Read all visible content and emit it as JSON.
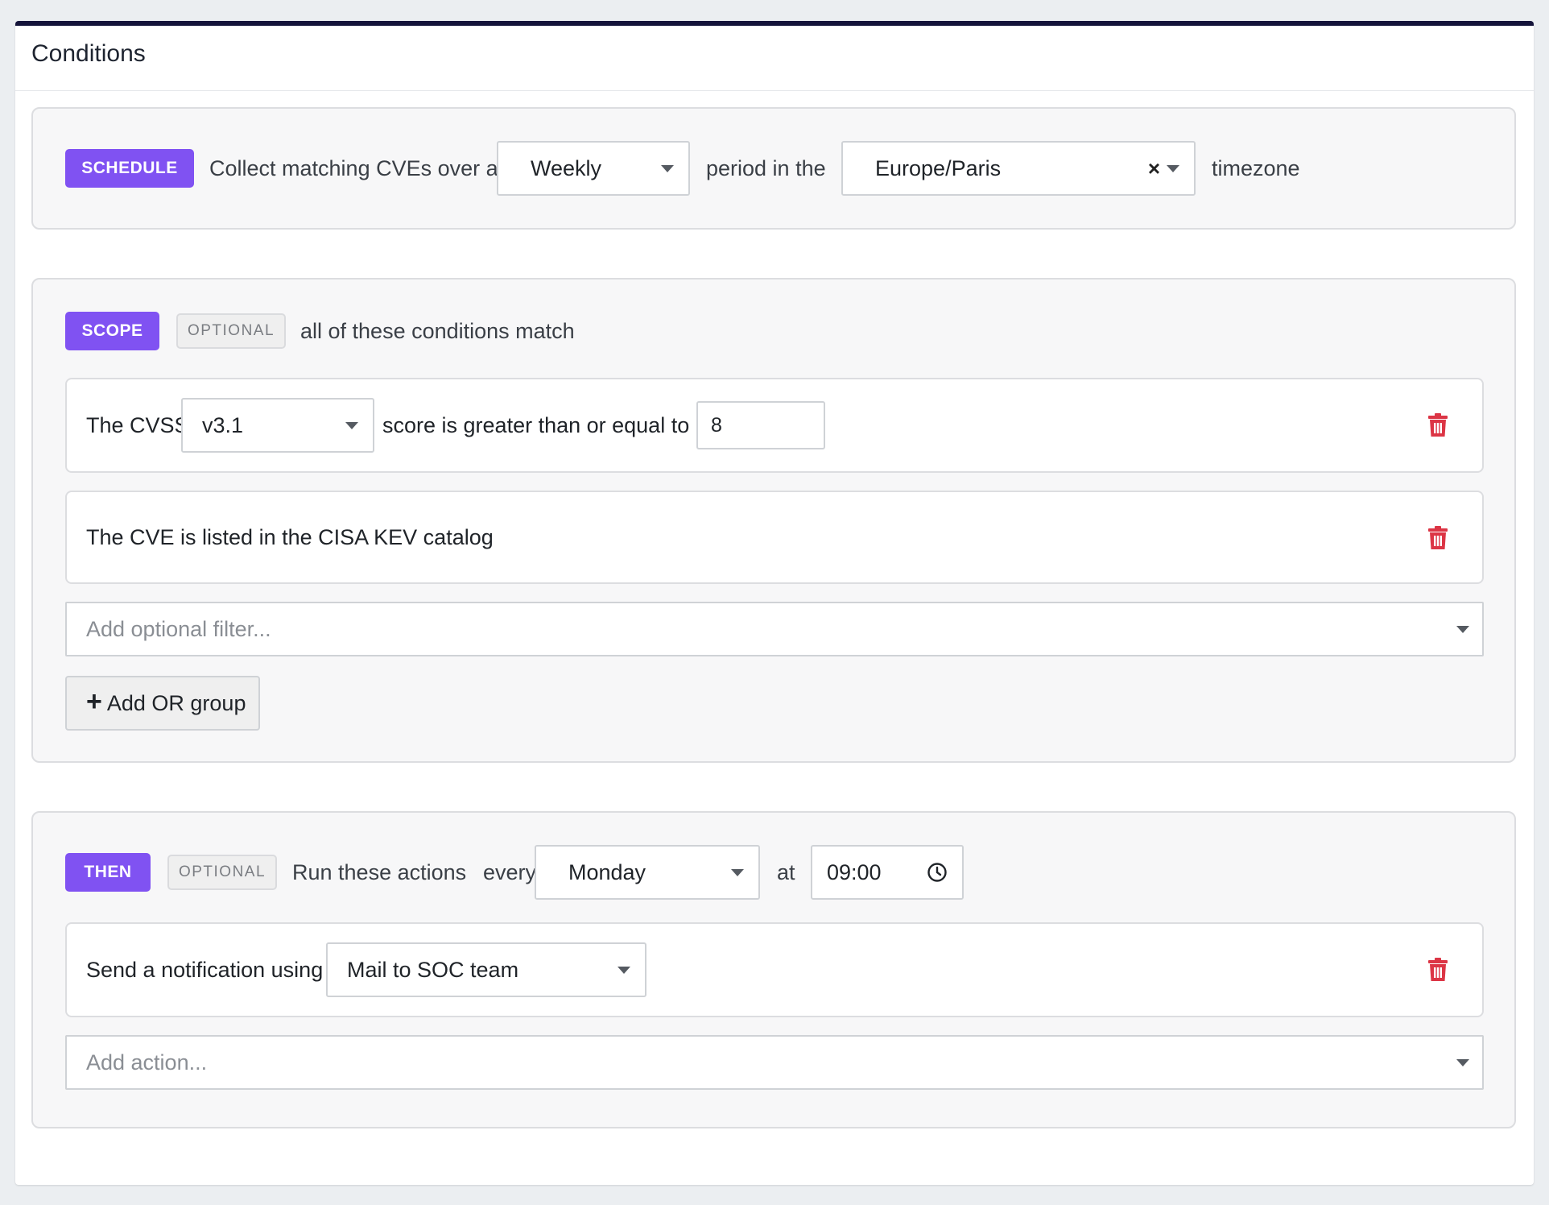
{
  "card": {
    "title": "Conditions"
  },
  "schedule": {
    "badge": "SCHEDULE",
    "text_before": "Collect matching CVEs over a",
    "period_value": "Weekly",
    "text_middle": "period in the",
    "timezone_value": "Europe/Paris",
    "timezone_clear": "×",
    "text_after": "timezone"
  },
  "scope": {
    "badge": "SCOPE",
    "optional": "OPTIONAL",
    "text": "all of these conditions match",
    "conditions": [
      {
        "text_before": "The CVSS",
        "version_value": "v3.1",
        "text_after": "score is greater than or equal to",
        "score_value": "8"
      },
      {
        "text": "The CVE is listed in the CISA KEV catalog"
      }
    ],
    "add_filter_placeholder": "Add optional filter...",
    "add_or_group_plus": "+",
    "add_or_group_label": "Add OR group"
  },
  "then": {
    "badge": "THEN",
    "optional": "OPTIONAL",
    "text_before": "Run these actions",
    "text_every": "every",
    "day_value": "Monday",
    "text_at": "at",
    "time_value": "09:00",
    "actions": [
      {
        "text": "Send a notification using",
        "channel_value": "Mail to SOC team"
      }
    ],
    "add_action_placeholder": "Add action..."
  },
  "colors": {
    "accent": "#8052f2",
    "danger": "#dc3545",
    "header_bar": "#14133a"
  },
  "icons": [
    "trash-icon",
    "clock-icon",
    "caret-down-icon",
    "plus-icon",
    "clear-icon"
  ]
}
